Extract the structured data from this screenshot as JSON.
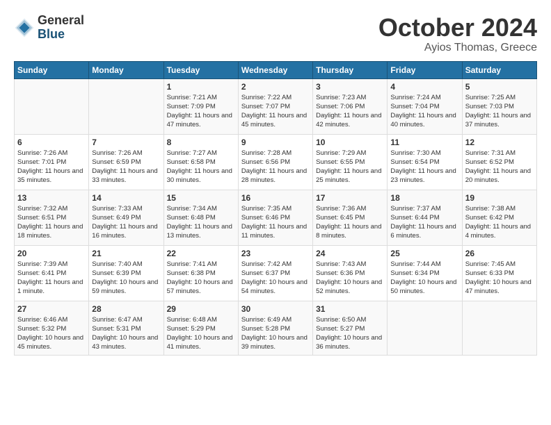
{
  "header": {
    "logo_line1": "General",
    "logo_line2": "Blue",
    "month": "October 2024",
    "location": "Ayios Thomas, Greece"
  },
  "weekdays": [
    "Sunday",
    "Monday",
    "Tuesday",
    "Wednesday",
    "Thursday",
    "Friday",
    "Saturday"
  ],
  "weeks": [
    [
      {
        "day": "",
        "info": ""
      },
      {
        "day": "",
        "info": ""
      },
      {
        "day": "1",
        "info": "Sunrise: 7:21 AM\nSunset: 7:09 PM\nDaylight: 11 hours and 47 minutes."
      },
      {
        "day": "2",
        "info": "Sunrise: 7:22 AM\nSunset: 7:07 PM\nDaylight: 11 hours and 45 minutes."
      },
      {
        "day": "3",
        "info": "Sunrise: 7:23 AM\nSunset: 7:06 PM\nDaylight: 11 hours and 42 minutes."
      },
      {
        "day": "4",
        "info": "Sunrise: 7:24 AM\nSunset: 7:04 PM\nDaylight: 11 hours and 40 minutes."
      },
      {
        "day": "5",
        "info": "Sunrise: 7:25 AM\nSunset: 7:03 PM\nDaylight: 11 hours and 37 minutes."
      }
    ],
    [
      {
        "day": "6",
        "info": "Sunrise: 7:26 AM\nSunset: 7:01 PM\nDaylight: 11 hours and 35 minutes."
      },
      {
        "day": "7",
        "info": "Sunrise: 7:26 AM\nSunset: 6:59 PM\nDaylight: 11 hours and 33 minutes."
      },
      {
        "day": "8",
        "info": "Sunrise: 7:27 AM\nSunset: 6:58 PM\nDaylight: 11 hours and 30 minutes."
      },
      {
        "day": "9",
        "info": "Sunrise: 7:28 AM\nSunset: 6:56 PM\nDaylight: 11 hours and 28 minutes."
      },
      {
        "day": "10",
        "info": "Sunrise: 7:29 AM\nSunset: 6:55 PM\nDaylight: 11 hours and 25 minutes."
      },
      {
        "day": "11",
        "info": "Sunrise: 7:30 AM\nSunset: 6:54 PM\nDaylight: 11 hours and 23 minutes."
      },
      {
        "day": "12",
        "info": "Sunrise: 7:31 AM\nSunset: 6:52 PM\nDaylight: 11 hours and 20 minutes."
      }
    ],
    [
      {
        "day": "13",
        "info": "Sunrise: 7:32 AM\nSunset: 6:51 PM\nDaylight: 11 hours and 18 minutes."
      },
      {
        "day": "14",
        "info": "Sunrise: 7:33 AM\nSunset: 6:49 PM\nDaylight: 11 hours and 16 minutes."
      },
      {
        "day": "15",
        "info": "Sunrise: 7:34 AM\nSunset: 6:48 PM\nDaylight: 11 hours and 13 minutes."
      },
      {
        "day": "16",
        "info": "Sunrise: 7:35 AM\nSunset: 6:46 PM\nDaylight: 11 hours and 11 minutes."
      },
      {
        "day": "17",
        "info": "Sunrise: 7:36 AM\nSunset: 6:45 PM\nDaylight: 11 hours and 8 minutes."
      },
      {
        "day": "18",
        "info": "Sunrise: 7:37 AM\nSunset: 6:44 PM\nDaylight: 11 hours and 6 minutes."
      },
      {
        "day": "19",
        "info": "Sunrise: 7:38 AM\nSunset: 6:42 PM\nDaylight: 11 hours and 4 minutes."
      }
    ],
    [
      {
        "day": "20",
        "info": "Sunrise: 7:39 AM\nSunset: 6:41 PM\nDaylight: 11 hours and 1 minute."
      },
      {
        "day": "21",
        "info": "Sunrise: 7:40 AM\nSunset: 6:39 PM\nDaylight: 10 hours and 59 minutes."
      },
      {
        "day": "22",
        "info": "Sunrise: 7:41 AM\nSunset: 6:38 PM\nDaylight: 10 hours and 57 minutes."
      },
      {
        "day": "23",
        "info": "Sunrise: 7:42 AM\nSunset: 6:37 PM\nDaylight: 10 hours and 54 minutes."
      },
      {
        "day": "24",
        "info": "Sunrise: 7:43 AM\nSunset: 6:36 PM\nDaylight: 10 hours and 52 minutes."
      },
      {
        "day": "25",
        "info": "Sunrise: 7:44 AM\nSunset: 6:34 PM\nDaylight: 10 hours and 50 minutes."
      },
      {
        "day": "26",
        "info": "Sunrise: 7:45 AM\nSunset: 6:33 PM\nDaylight: 10 hours and 47 minutes."
      }
    ],
    [
      {
        "day": "27",
        "info": "Sunrise: 6:46 AM\nSunset: 5:32 PM\nDaylight: 10 hours and 45 minutes."
      },
      {
        "day": "28",
        "info": "Sunrise: 6:47 AM\nSunset: 5:31 PM\nDaylight: 10 hours and 43 minutes."
      },
      {
        "day": "29",
        "info": "Sunrise: 6:48 AM\nSunset: 5:29 PM\nDaylight: 10 hours and 41 minutes."
      },
      {
        "day": "30",
        "info": "Sunrise: 6:49 AM\nSunset: 5:28 PM\nDaylight: 10 hours and 39 minutes."
      },
      {
        "day": "31",
        "info": "Sunrise: 6:50 AM\nSunset: 5:27 PM\nDaylight: 10 hours and 36 minutes."
      },
      {
        "day": "",
        "info": ""
      },
      {
        "day": "",
        "info": ""
      }
    ]
  ]
}
